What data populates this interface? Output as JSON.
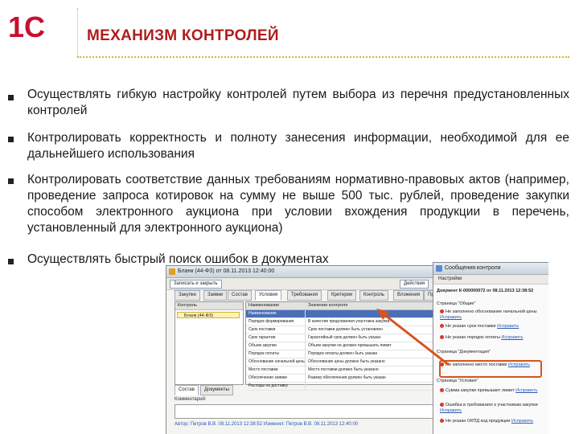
{
  "header": {
    "logo_text": "1С",
    "title": "МЕХАНИЗМ КОНТРОЛЕЙ"
  },
  "bullets": [
    "Осуществлять гибкую настройку контролей путем выбора из перечня предустановленных контролей",
    "Контролировать корректность и полноту занесения информации, необходимой для ее дальнейшего использования",
    "Контролировать соответствие данных требованиям нормативно-правовых актов (например, проведение запроса котировок на сумму не выше 500 тыс. рублей, проведение закупки способом электронного аукциона при условии вхождения продукции в перечень, установленный для электронного аукциона)",
    "Осуществлять быстрый поиск ошибок в документах"
  ],
  "screenshot": {
    "main_window": {
      "title": "Бланк (44-ФЗ) от 08.11.2013 12:40:00",
      "toolbar": {
        "record_button": "Записать и закрыть",
        "actions": "Действия"
      },
      "tabs": [
        "Закупки",
        "Заявки",
        "Состав",
        "Условия",
        "Требования",
        "Критерии",
        "Контроль",
        "Вложения",
        "Прочее"
      ],
      "left_header": "Контроль",
      "left_selected": "Бланк (44-ФЗ)",
      "grid_headers": [
        "Наименование",
        "Значение контроля"
      ],
      "grid_rows": [
        [
          "Наименование",
          ""
        ],
        [
          "Порядок формирования",
          "В качестве предложения участника закупки"
        ],
        [
          "Срок поставки",
          "Срок поставки должен быть установлен"
        ],
        [
          "Срок гарантии",
          "Гарантийный срок должен быть указан"
        ],
        [
          "Объем закупки",
          "Объем закупки не должен превышать лимит"
        ],
        [
          "Порядок оплаты",
          "Порядок оплаты должен быть указан"
        ],
        [
          "Обоснование начальной цены",
          "Обоснование цены должно быть указано"
        ],
        [
          "Место поставки",
          "Место поставки должно быть указано"
        ],
        [
          "Обеспечение заявки",
          "Размер обеспечения должен быть указан"
        ],
        [
          "Расходы на доставку",
          ""
        ]
      ],
      "bottom_tabs": [
        "Состав",
        "Документы"
      ],
      "comment_label": "Комментарий:",
      "status_line": "Автор: Петров В.В. 08.11.2013 12:38:52    Изменил: Петров В.В. 08.11.2013 12:40:00"
    },
    "messages_window": {
      "title": "Сообщения контроля",
      "subtitle": "Настройки",
      "items": [
        {
          "text": "Документ К-000000072 от 08.11.2013 12:38:52",
          "level": "header"
        },
        {
          "text": "Страница \"Общие\"",
          "level": "group"
        },
        {
          "text": "Не заполнено обоснование начальной цены",
          "link": "Исправить",
          "level": "error"
        },
        {
          "text": "Не указан срок поставки",
          "link": "Исправить",
          "level": "error"
        },
        {
          "text": "Не указан порядок оплаты",
          "link": "Исправить",
          "level": "error"
        },
        {
          "text": "Страница \"Документация\"",
          "level": "group"
        },
        {
          "text": "Не заполнено место поставки",
          "link": "Исправить",
          "level": "error"
        },
        {
          "text": "Страница \"Условия\"",
          "level": "group"
        },
        {
          "text": "Сумма закупки превышает лимит",
          "link": "Исправить",
          "level": "error"
        },
        {
          "text": "Ошибка в требованиях к участникам закупки",
          "link": "Исправить",
          "level": "error"
        },
        {
          "text": "Не указан ОКПД код продукции",
          "link": "Исправить",
          "level": "error"
        }
      ]
    }
  },
  "colors": {
    "title": "#b01c1c",
    "accent_line": "#d6b23a",
    "highlight": "#d9531e",
    "link": "#2a5ab8"
  }
}
